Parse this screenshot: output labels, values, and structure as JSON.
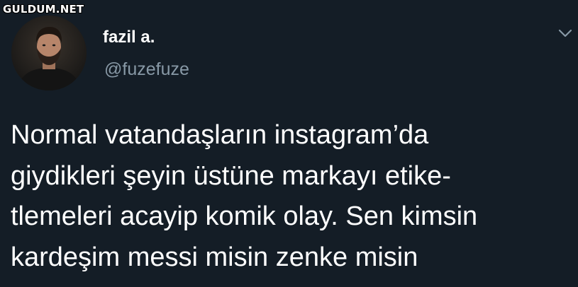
{
  "watermark": "GULDUM.NET",
  "author": {
    "display_name": "fazil a.",
    "handle": "@fuzefuze"
  },
  "menu_icon": "chevron-down-icon",
  "tweet": {
    "lines": [
      "Normal vatandaşların instagram’da",
      "giydikleri şeyin üstüne markayı etike-",
      "tlemeleri acayip komik olay. Sen kimsin",
      "kardeşim messi misin zenke misin"
    ]
  },
  "colors": {
    "background": "#141d26",
    "text": "#ffffff",
    "secondary": "#8899a6"
  }
}
